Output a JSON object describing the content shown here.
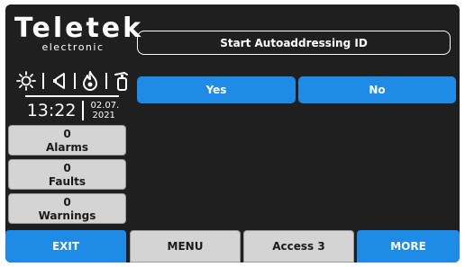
{
  "logo": {
    "brand": "Teletek",
    "sub": "electronic"
  },
  "status_icons": [
    "sun-icon",
    "speaker-icon",
    "fire-icon",
    "extinguisher-icon"
  ],
  "clock": {
    "time": "13:22",
    "date_day_month": "02.07.",
    "date_year": "2021"
  },
  "counters": [
    {
      "count": "0",
      "label": "Alarms"
    },
    {
      "count": "0",
      "label": "Faults"
    },
    {
      "count": "0",
      "label": "Warnings"
    }
  ],
  "dialog": {
    "title": "Start Autoaddressing ID",
    "yes_label": "Yes",
    "no_label": "No"
  },
  "bottom_bar": {
    "exit": "EXIT",
    "menu": "MENU",
    "access": "Access 3",
    "more": "MORE"
  },
  "colors": {
    "background": "#1f1f1f",
    "accent_blue": "#1e8ce6",
    "button_gray": "#d4d4d4",
    "text_light": "#ffffff"
  }
}
